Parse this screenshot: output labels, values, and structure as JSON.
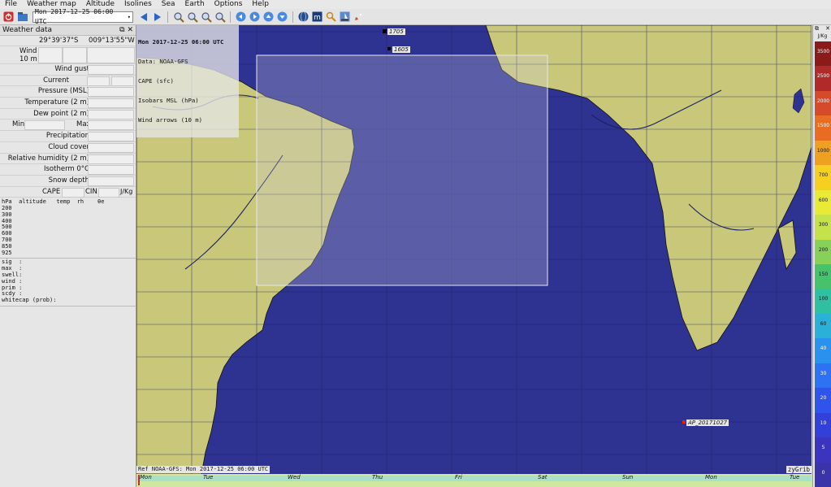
{
  "menu": [
    "File",
    "Weather map",
    "Altitude",
    "Isolines",
    "Sea",
    "Earth",
    "Options",
    "Help"
  ],
  "toolbar": {
    "date_value": "Mon 2017-12-25 06:00 UTC",
    "icons": [
      "quit-icon",
      "open-file-icon",
      "prev-icon",
      "next-icon",
      "zoom-in-icon",
      "zoom-out-icon",
      "zoom-fit-icon",
      "zoom-all-icon",
      "left-icon",
      "right-icon",
      "up-icon",
      "down-icon",
      "globe-icon",
      "metar-icon",
      "tools-icon",
      "boat-icon",
      "rocket-icon"
    ]
  },
  "panel": {
    "title": "Weather data",
    "lat": "29°39'37\"S",
    "lon": "009°13'55\"W",
    "wind_label": "Wind",
    "wind_sub": "10 m",
    "rows": [
      "Wind gust",
      "Current",
      "Pressure (MSL)",
      "Temperature (2 m)",
      "Dew point (2 m)"
    ],
    "min_label": "Min",
    "max_label": "Max",
    "rows2": [
      "Precipitation",
      "Cloud cover",
      "Relative humidity (2 m)",
      "Isotherm 0°C",
      "Snow depth"
    ],
    "cape_label": "CAPE",
    "cin_label": "CIN",
    "unit_label": "J/Kg",
    "sounding_header": "hPa  altitude   temp  rh    θe",
    "sounding_levels": [
      "200",
      "300",
      "400",
      "500",
      "600",
      "700",
      "850",
      "925"
    ],
    "sea_lines": [
      "sig  :",
      "max  :",
      "swell:",
      "wind :",
      "prim :",
      "scdy :",
      "whitecap (prob):"
    ]
  },
  "map": {
    "overlay_lines": [
      "Mon 2017-12-25 06:00 UTC",
      "Data: NOAA-GFS",
      "CAPE (sfc)",
      "Isobars MSL (hPa)",
      "Wind arrows (10 m)"
    ],
    "point_labels": [
      "1705",
      "1605",
      "AP_20171027"
    ],
    "footer": "Ref NOAA-GFS: Mon 2017-12-25 06:00 UTC",
    "brand": "zyGrib",
    "colors": {
      "ocean": "#2e3290",
      "land": "#c9c77a",
      "grid": "#1e2166",
      "selection": "#cfcfdf"
    }
  },
  "timeline": {
    "days": [
      "Mon",
      "Tue",
      "Wed",
      "Thu",
      "Fri",
      "Sat",
      "Sun",
      "Mon",
      "Tue"
    ]
  },
  "legend": {
    "unit": "J/Kg",
    "values": [
      "3500",
      "2500",
      "2000",
      "1500",
      "1000",
      "700",
      "600",
      "300",
      "200",
      "150",
      "100",
      "60",
      "40",
      "30",
      "20",
      "10",
      "5",
      "0"
    ],
    "colors": [
      "#8b1a1a",
      "#b02a2a",
      "#d44a2a",
      "#e86c22",
      "#f0a020",
      "#f6d020",
      "#e9ea35",
      "#c6e24a",
      "#87d15a",
      "#46c26c",
      "#2fc0a2",
      "#2bb0d8",
      "#2a92ee",
      "#2c72f2",
      "#2e54ec",
      "#3340d8",
      "#3a34bf",
      "#3b33a8"
    ]
  }
}
